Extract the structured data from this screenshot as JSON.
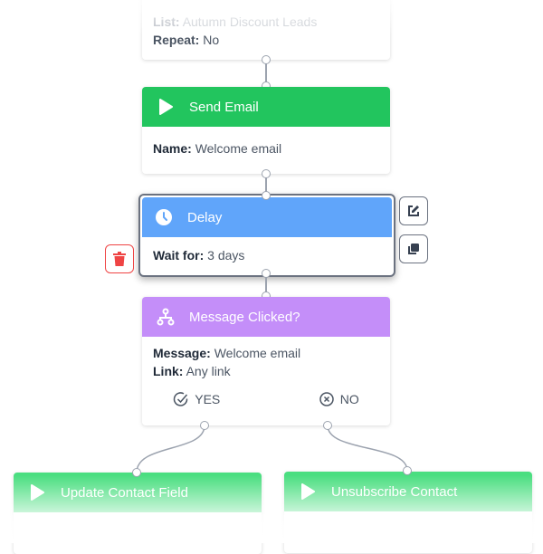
{
  "trigger_card": {
    "list_label": "List:",
    "list_value": "Autumn Discount Leads",
    "repeat_label": "Repeat:",
    "repeat_value": "No"
  },
  "send_email_card": {
    "title": "Send Email",
    "icon": "play-icon",
    "color": "#22c55e",
    "name_label": "Name:",
    "name_value": "Welcome email"
  },
  "delay_card": {
    "title": "Delay",
    "icon": "clock-icon",
    "color": "#60a5fa",
    "wait_label": "Wait for:",
    "wait_value": "3 days",
    "selected": true
  },
  "side_actions": {
    "edit_icon": "edit-icon",
    "duplicate_icon": "duplicate-icon",
    "delete_icon": "trash-icon",
    "delete_color": "#ef4444"
  },
  "condition_card": {
    "title": "Message Clicked?",
    "icon": "branch-icon",
    "color": "#c084fc",
    "message_label": "Message:",
    "message_value": "Welcome email",
    "link_label": "Link:",
    "link_value": "Any link",
    "yes_label": "YES",
    "no_label": "NO"
  },
  "yes_branch_card": {
    "title": "Update Contact Field",
    "icon": "play-icon",
    "color": "#86efac"
  },
  "no_branch_card": {
    "title": "Unsubscribe Contact",
    "icon": "play-icon",
    "color": "#86efac"
  }
}
